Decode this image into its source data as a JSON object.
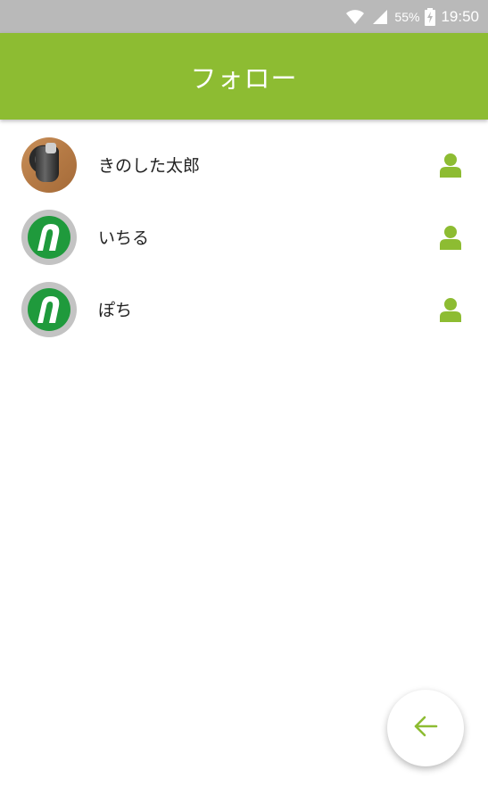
{
  "status_bar": {
    "battery": "55%",
    "time": "19:50",
    "icons": [
      "wifi-icon",
      "signal-icon",
      "battery-charging-icon"
    ]
  },
  "app_bar": {
    "title": "フォロー"
  },
  "follow_list": [
    {
      "name": "きのした太郎",
      "avatar": "photo-avatar",
      "action_icon": "person-icon"
    },
    {
      "name": "いちる",
      "avatar": "app-logo-avatar",
      "action_icon": "person-icon"
    },
    {
      "name": "ぽち",
      "avatar": "app-logo-avatar",
      "action_icon": "person-icon"
    }
  ],
  "fab": {
    "icon": "arrow-left-icon"
  },
  "colors": {
    "accent": "#8dbc32",
    "status_bar": "#b9b9b9",
    "logo_green": "#1f9a3c"
  }
}
